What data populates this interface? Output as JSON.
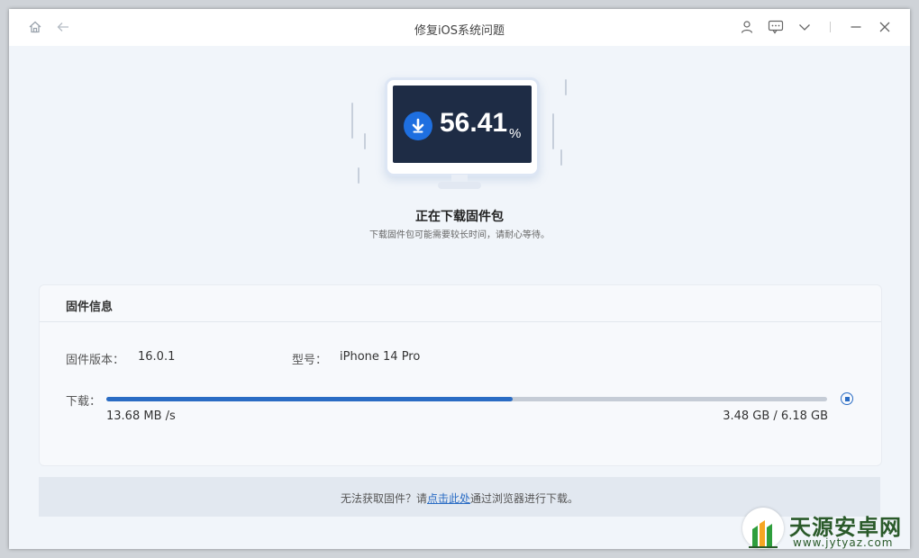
{
  "window": {
    "title": "修复iOS系统问题"
  },
  "progress": {
    "percent_value": "56.41",
    "percent_sign": "%",
    "fraction": 0.5641
  },
  "status": {
    "heading": "正在下载固件包",
    "subtext": "下载固件包可能需要较长时间，请耐心等待。"
  },
  "firmware": {
    "section_title": "固件信息",
    "version_label": "固件版本：",
    "version_value": "16.0.1",
    "model_label": "型号：",
    "model_value": "iPhone 14 Pro",
    "download_label": "下载：",
    "speed": "13.68 MB /s",
    "size": "3.48 GB / 6.18 GB"
  },
  "footer": {
    "prefix": "无法获取固件？请",
    "link": "点击此处",
    "suffix": "通过浏览器进行下载。"
  },
  "watermark": {
    "title": "天源安卓网",
    "url": "www.jytyaz.com"
  },
  "colors": {
    "accent": "#2a6cc4",
    "screen": "#1e2c45",
    "download_icon": "#1e6fe0"
  },
  "icons": [
    "home-icon",
    "back-arrow-icon",
    "user-icon",
    "feedback-icon",
    "chevron-down-icon",
    "minimize-icon",
    "close-icon",
    "download-arrow-icon",
    "stop-icon"
  ]
}
